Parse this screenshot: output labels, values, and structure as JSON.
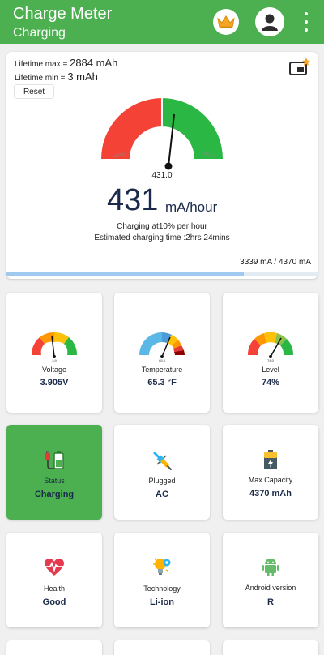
{
  "app": {
    "title": "Charge Meter",
    "subtitle": "Charging",
    "icons": [
      "crown-icon",
      "profile-icon",
      "more-vert-icon"
    ]
  },
  "main": {
    "lifetime_max_label": "Lifetime max =",
    "lifetime_max_value": "2884 mAh",
    "lifetime_min_label": "Lifetime min =",
    "lifetime_min_value": "3 mAh",
    "reset_label": "Reset",
    "gauge_min_label": "-3500.0",
    "gauge_max_label": "3500.0",
    "needle_value": "431.0",
    "current": "431",
    "unit": "mA/hour",
    "charging_rate": "Charging at10% per hour",
    "estimate": "Estimated charging time :2hrs 24mins",
    "capacity_ratio": "3339 mA / 4370 mA",
    "progress_fraction": 0.764,
    "colors": {
      "red": "#f44336",
      "green": "#2bb744"
    }
  },
  "tiles": [
    {
      "label": "Voltage",
      "value": "3.905V",
      "gauge_label": "3.9"
    },
    {
      "label": "Temperature",
      "value": "65.3 °F",
      "gauge_label": "65.3"
    },
    {
      "label": "Level",
      "value": "74%",
      "gauge_label": "74.0"
    },
    {
      "label": "Status",
      "value": "Charging",
      "icon": "battery-charging-icon"
    },
    {
      "label": "Plugged",
      "value": "AC",
      "icon": "plug-icon"
    },
    {
      "label": "Max Capacity",
      "value": "4370 mAh",
      "icon": "battery-icon"
    },
    {
      "label": "Health",
      "value": "Good",
      "icon": "heart-pulse-icon"
    },
    {
      "label": "Technology",
      "value": "Li-ion",
      "icon": "lightbulb-gear-icon"
    },
    {
      "label": "Android version",
      "value": "R",
      "icon": "android-icon"
    }
  ]
}
